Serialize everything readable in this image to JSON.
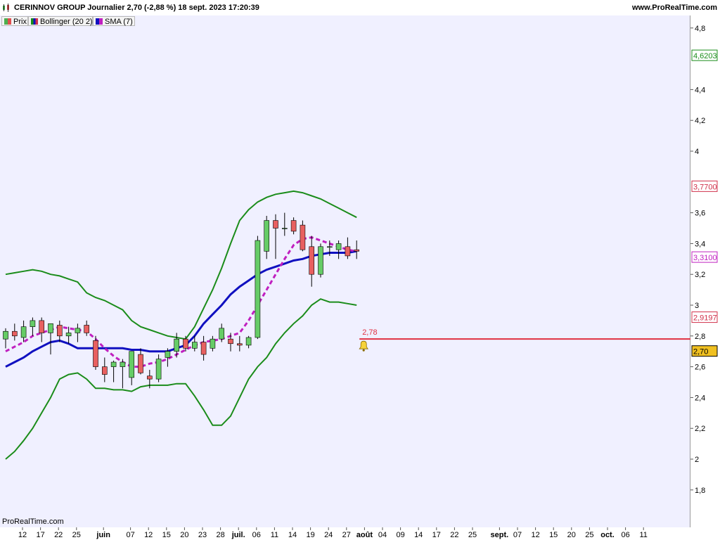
{
  "header": {
    "title": "CERINNOV GROUP Journalier 2,70 (-2,88 %) 18 sept. 2023 17:20:39",
    "site": "www.ProRealTime.com"
  },
  "legend": [
    {
      "label": "Prix",
      "color": "#4caf50"
    },
    {
      "label": "Bollinger (20 2)",
      "color": "#d0304a"
    },
    {
      "label": "SMA (7)",
      "color": "#c020c0"
    }
  ],
  "footer": {
    "brand": "ProRealTime.com"
  },
  "chart_data": {
    "type": "candlestick",
    "yaxis": {
      "range": [
        1.6,
        4.9
      ],
      "ticks": [
        "4,8",
        "4,4",
        "4,2",
        "4",
        "3,6",
        "3,4",
        "3,2",
        "3",
        "2,8",
        "2,6",
        "2,4",
        "2,2",
        "2",
        "1,8"
      ]
    },
    "xaxis": {
      "labels": [
        {
          "i": 0,
          "text": "12",
          "bold": false
        },
        {
          "i": 2,
          "text": "17",
          "bold": false
        },
        {
          "i": 4,
          "text": "22",
          "bold": false
        },
        {
          "i": 6,
          "text": "25",
          "bold": false
        },
        {
          "i": 9,
          "text": "juin",
          "bold": true
        },
        {
          "i": 12,
          "text": "07",
          "bold": false
        },
        {
          "i": 14,
          "text": "12",
          "bold": false
        },
        {
          "i": 16,
          "text": "15",
          "bold": false
        },
        {
          "i": 18,
          "text": "20",
          "bold": false
        },
        {
          "i": 20,
          "text": "23",
          "bold": false
        },
        {
          "i": 22,
          "text": "28",
          "bold": false
        },
        {
          "i": 24,
          "text": "juil.",
          "bold": true
        },
        {
          "i": 26,
          "text": "06",
          "bold": false
        },
        {
          "i": 28,
          "text": "11",
          "bold": false
        },
        {
          "i": 30,
          "text": "14",
          "bold": false
        },
        {
          "i": 32,
          "text": "19",
          "bold": false
        },
        {
          "i": 34,
          "text": "24",
          "bold": false
        },
        {
          "i": 36,
          "text": "27",
          "bold": false
        },
        {
          "i": 38,
          "text": "août",
          "bold": true
        },
        {
          "i": 40,
          "text": "04",
          "bold": false
        },
        {
          "i": 42,
          "text": "09",
          "bold": false
        },
        {
          "i": 44,
          "text": "14",
          "bold": false
        },
        {
          "i": 46,
          "text": "17",
          "bold": false
        },
        {
          "i": 48,
          "text": "22",
          "bold": false
        },
        {
          "i": 50,
          "text": "25",
          "bold": false
        },
        {
          "i": 53,
          "text": "sept.",
          "bold": true
        },
        {
          "i": 55,
          "text": "07",
          "bold": false
        },
        {
          "i": 57,
          "text": "12",
          "bold": false
        },
        {
          "i": 59,
          "text": "15",
          "bold": false
        },
        {
          "i": 61,
          "text": "20",
          "bold": false
        },
        {
          "i": 63,
          "text": "25",
          "bold": false
        },
        {
          "i": 65,
          "text": "oct.",
          "bold": true
        },
        {
          "i": 67,
          "text": "06",
          "bold": false
        },
        {
          "i": 69,
          "text": "11",
          "bold": false
        }
      ]
    },
    "candles": [
      {
        "o": 2.78,
        "h": 2.85,
        "l": 2.72,
        "c": 2.83
      },
      {
        "o": 2.83,
        "h": 2.88,
        "l": 2.77,
        "c": 2.8
      },
      {
        "o": 2.79,
        "h": 2.9,
        "l": 2.76,
        "c": 2.86
      },
      {
        "o": 2.86,
        "h": 2.92,
        "l": 2.8,
        "c": 2.9
      },
      {
        "o": 2.9,
        "h": 2.92,
        "l": 2.76,
        "c": 2.82
      },
      {
        "o": 2.82,
        "h": 2.88,
        "l": 2.68,
        "c": 2.88
      },
      {
        "o": 2.87,
        "h": 2.9,
        "l": 2.76,
        "c": 2.8
      },
      {
        "o": 2.8,
        "h": 2.86,
        "l": 2.75,
        "c": 2.82
      },
      {
        "o": 2.82,
        "h": 2.88,
        "l": 2.76,
        "c": 2.85
      },
      {
        "o": 2.87,
        "h": 2.9,
        "l": 2.8,
        "c": 2.82
      },
      {
        "o": 2.77,
        "h": 2.8,
        "l": 2.58,
        "c": 2.6
      },
      {
        "o": 2.6,
        "h": 2.66,
        "l": 2.5,
        "c": 2.55
      },
      {
        "o": 2.6,
        "h": 2.64,
        "l": 2.5,
        "c": 2.63
      },
      {
        "o": 2.6,
        "h": 2.65,
        "l": 2.46,
        "c": 2.63
      },
      {
        "o": 2.53,
        "h": 2.7,
        "l": 2.48,
        "c": 2.7
      },
      {
        "o": 2.68,
        "h": 2.72,
        "l": 2.55,
        "c": 2.56
      },
      {
        "o": 2.54,
        "h": 2.58,
        "l": 2.46,
        "c": 2.52
      },
      {
        "o": 2.52,
        "h": 2.68,
        "l": 2.5,
        "c": 2.65
      },
      {
        "o": 2.66,
        "h": 2.72,
        "l": 2.6,
        "c": 2.7
      },
      {
        "o": 2.7,
        "h": 2.82,
        "l": 2.66,
        "c": 2.78
      },
      {
        "o": 2.78,
        "h": 2.8,
        "l": 2.7,
        "c": 2.72
      },
      {
        "o": 2.72,
        "h": 2.8,
        "l": 2.7,
        "c": 2.76
      },
      {
        "o": 2.76,
        "h": 2.8,
        "l": 2.64,
        "c": 2.68
      },
      {
        "o": 2.72,
        "h": 2.8,
        "l": 2.7,
        "c": 2.78
      },
      {
        "o": 2.78,
        "h": 2.88,
        "l": 2.76,
        "c": 2.85
      },
      {
        "o": 2.78,
        "h": 2.82,
        "l": 2.7,
        "c": 2.75
      },
      {
        "o": 2.75,
        "h": 2.8,
        "l": 2.7,
        "c": 2.74
      },
      {
        "o": 2.74,
        "h": 2.8,
        "l": 2.72,
        "c": 2.79
      },
      {
        "o": 2.79,
        "h": 3.45,
        "l": 2.78,
        "c": 3.42
      },
      {
        "o": 3.35,
        "h": 3.58,
        "l": 3.3,
        "c": 3.55
      },
      {
        "o": 3.55,
        "h": 3.59,
        "l": 3.3,
        "c": 3.5
      },
      {
        "o": 3.5,
        "h": 3.6,
        "l": 3.45,
        "c": 3.5
      },
      {
        "o": 3.55,
        "h": 3.57,
        "l": 3.46,
        "c": 3.48
      },
      {
        "o": 3.52,
        "h": 3.55,
        "l": 3.35,
        "c": 3.36
      },
      {
        "o": 3.38,
        "h": 3.45,
        "l": 3.12,
        "c": 3.2
      },
      {
        "o": 3.2,
        "h": 3.4,
        "l": 3.18,
        "c": 3.38
      },
      {
        "o": 3.38,
        "h": 3.42,
        "l": 3.32,
        "c": 3.38
      },
      {
        "o": 3.36,
        "h": 3.42,
        "l": 3.3,
        "c": 3.4
      },
      {
        "o": 3.38,
        "h": 3.44,
        "l": 3.3,
        "c": 3.32
      },
      {
        "o": 3.36,
        "h": 3.42,
        "l": 3.3,
        "c": 3.35
      }
    ],
    "bollinger_upper": [
      3.2,
      3.21,
      3.22,
      3.23,
      3.22,
      3.2,
      3.19,
      3.17,
      3.15,
      3.08,
      3.05,
      3.03,
      3.0,
      2.97,
      2.9,
      2.86,
      2.84,
      2.82,
      2.8,
      2.79,
      2.78,
      2.86,
      2.98,
      3.1,
      3.24,
      3.4,
      3.55,
      3.62,
      3.67,
      3.7,
      3.72,
      3.73,
      3.74,
      3.73,
      3.71,
      3.69,
      3.66,
      3.63,
      3.6,
      3.57
    ],
    "bollinger_lower": [
      2.0,
      2.05,
      2.12,
      2.2,
      2.3,
      2.4,
      2.52,
      2.55,
      2.56,
      2.52,
      2.46,
      2.46,
      2.45,
      2.45,
      2.44,
      2.47,
      2.48,
      2.48,
      2.48,
      2.49,
      2.49,
      2.41,
      2.32,
      2.22,
      2.22,
      2.28,
      2.4,
      2.52,
      2.6,
      2.66,
      2.75,
      2.82,
      2.88,
      2.93,
      3.0,
      3.04,
      3.02,
      3.02,
      3.01,
      3.0
    ],
    "bollinger_middle": [
      2.6,
      2.63,
      2.66,
      2.7,
      2.73,
      2.76,
      2.77,
      2.75,
      2.72,
      2.72,
      2.72,
      2.72,
      2.72,
      2.72,
      2.71,
      2.71,
      2.7,
      2.7,
      2.7,
      2.72,
      2.74,
      2.8,
      2.88,
      2.94,
      3.0,
      3.07,
      3.12,
      3.16,
      3.2,
      3.23,
      3.25,
      3.27,
      3.29,
      3.3,
      3.32,
      3.33,
      3.34,
      3.34,
      3.34,
      3.35
    ],
    "sma7": [
      2.7,
      2.73,
      2.76,
      2.8,
      2.82,
      2.84,
      2.86,
      2.85,
      2.84,
      2.83,
      2.78,
      2.72,
      2.67,
      2.63,
      2.6,
      2.6,
      2.62,
      2.63,
      2.65,
      2.68,
      2.71,
      2.74,
      2.76,
      2.77,
      2.78,
      2.8,
      2.82,
      2.9,
      3.0,
      3.1,
      3.2,
      3.3,
      3.39,
      3.43,
      3.44,
      3.42,
      3.4,
      3.38,
      3.36,
      3.35
    ],
    "overlays_right": [
      {
        "value": "4,6203",
        "color": "#1a8c1a"
      },
      {
        "value": "3,7700",
        "color": "#d0304a"
      },
      {
        "value": "3,3100",
        "color": "#c020c0"
      },
      {
        "value": "2,9197",
        "color": "#d0304a"
      },
      {
        "value": "2,70",
        "color": "#000000",
        "bg": "#f0c020"
      }
    ],
    "price_line": {
      "value": 2.78,
      "label": "2,78",
      "color": "#e03040"
    }
  }
}
